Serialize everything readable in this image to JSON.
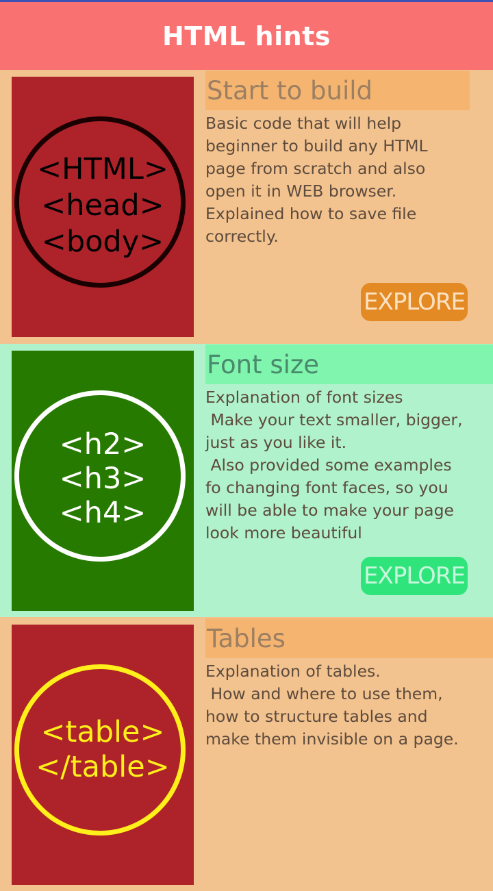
{
  "app": {
    "title": "HTML hints"
  },
  "cards": [
    {
      "image_lines": [
        "<HTML>",
        "<head>",
        "<body>"
      ],
      "title": "Start to build",
      "description": "Basic code that will help beginner to build any HTML page from scratch and also open it in WEB browser. Explained how to save file correctly.",
      "button": "EXPLORE",
      "colors": {
        "background": "#f3c38f",
        "image_bg": "#ae232a",
        "circle": "#1a0000",
        "image_text": "#000000",
        "title_bar": "#f5b571",
        "title_text": "#9c7f62",
        "button_bg": "#e38a25",
        "button_text": "#fde2c2"
      }
    },
    {
      "image_lines": [
        "<h2>",
        "<h3>",
        "<h4>"
      ],
      "title": "Font size",
      "description": "Explanation of font sizes\n Make your text smaller, bigger, just as you like it.\n Also provided some examples fo changing font faces, so you will be able to make your page look more beautiful",
      "button": "EXPLORE",
      "colors": {
        "background": "#b0f2cb",
        "image_bg": "#277a00",
        "circle": "#ffffff",
        "image_text": "#ffffff",
        "title_bar": "#80f5ad",
        "title_text": "#4a8a6c",
        "button_bg": "#2ee47b",
        "button_text": "#c9f7dc"
      }
    },
    {
      "image_lines": [
        "<table>",
        "</table>"
      ],
      "title": "Tables",
      "description": "Explanation of tables.\n How and where to use them, how to structure tables and make them invisible on a page.",
      "button": "",
      "colors": {
        "background": "#f3c38f",
        "image_bg": "#ae232a",
        "circle": "#ffef1a",
        "image_text": "#ffef1a",
        "title_bar": "#f5b571",
        "title_text": "#9c7f62",
        "button_bg": "#e38a25",
        "button_text": "#fde2c2"
      }
    }
  ]
}
